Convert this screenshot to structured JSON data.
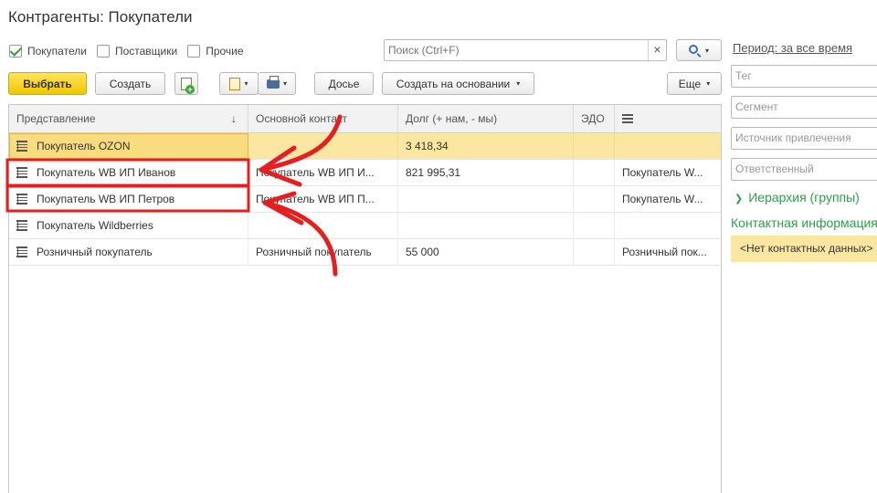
{
  "window": {
    "title": "Контрагенты: Покупатели"
  },
  "filters": [
    {
      "label": "Покупатели",
      "checked": true
    },
    {
      "label": "Поставщики",
      "checked": false
    },
    {
      "label": "Прочие",
      "checked": false
    }
  ],
  "search": {
    "placeholder": "Поиск (Ctrl+F)",
    "clear": "×"
  },
  "period": {
    "label": "Период: за все время"
  },
  "toolbar": {
    "select_label": "Выбрать",
    "create_label": "Создать",
    "dossier_label": "Досье",
    "create_basis_label": "Создать на основании",
    "more_label": "Еще",
    "dropdown_glyph": "▾"
  },
  "table": {
    "columns": [
      "Представление",
      "Основной контакт",
      "Долг (+ нам, - мы)",
      "ЭДО",
      ""
    ],
    "sort_glyph": "↓",
    "rows": [
      {
        "name": "Покупатель OZON",
        "contact": "",
        "debt": "3 418,34",
        "edo": "",
        "extra": ""
      },
      {
        "name": "Покупатель WB ИП Иванов",
        "contact": "Покупатель WB ИП И...",
        "debt": "821 995,31",
        "edo": "",
        "extra": "Покупатель W..."
      },
      {
        "name": "Покупатель WB ИП Петров",
        "contact": "Покупатель WB ИП П...",
        "debt": "",
        "edo": "",
        "extra": "Покупатель W..."
      },
      {
        "name": "Покупатель Wildberries",
        "contact": "",
        "debt": "",
        "edo": "",
        "extra": ""
      },
      {
        "name": "Розничный покупатель",
        "contact": "Розничный покупатель",
        "debt": "55 000",
        "edo": "",
        "extra": "Розничный пок..."
      }
    ]
  },
  "sidebar": {
    "fields": [
      {
        "placeholder": "Тег"
      },
      {
        "placeholder": "Сегмент"
      },
      {
        "placeholder": "Источник привлечения"
      },
      {
        "placeholder": "Ответственный"
      }
    ],
    "hierarchy_label": "Иерархия (группы)",
    "contact_header": "Контактная информация",
    "no_contact": "<Нет контактных данных>"
  },
  "annotation": {
    "color": "#e41f1f",
    "highlight_color": "#e41f1f"
  }
}
